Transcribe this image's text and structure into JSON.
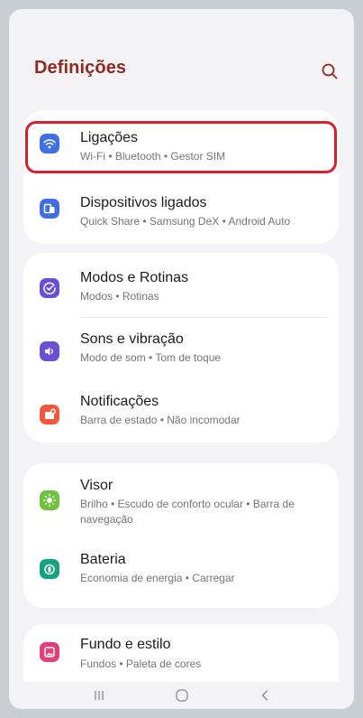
{
  "header": {
    "title": "Definições",
    "search_icon": "search-icon"
  },
  "groups": [
    {
      "items": [
        {
          "title": "Ligações",
          "subtitle": "Wi-Fi  •  Bluetooth  •  Gestor SIM",
          "icon": "wifi-icon",
          "color": "#3f6fe0"
        },
        {
          "title": "Dispositivos ligados",
          "subtitle": "Quick Share  •  Samsung DeX  •  Android Auto",
          "icon": "devices-icon",
          "color": "#3f6fe0"
        }
      ]
    },
    {
      "items": [
        {
          "title": "Modos e Rotinas",
          "subtitle": "Modos  •  Rotinas",
          "icon": "modes-check-icon",
          "color": "#6a4fd4"
        },
        {
          "title": "Sons e vibração",
          "subtitle": "Modo de som  •  Tom de toque",
          "icon": "speaker-icon",
          "color": "#6a4fd4"
        },
        {
          "title": "Notificações",
          "subtitle": "Barra de estado  •  Não incomodar",
          "icon": "notification-icon",
          "color": "#f0573d"
        }
      ]
    },
    {
      "items": [
        {
          "title": "Visor",
          "subtitle": "Brilho  •  Escudo de conforto ocular  •  Barra de navegação",
          "icon": "brightness-icon",
          "color": "#6fc23c"
        },
        {
          "title": "Bateria",
          "subtitle": "Economia de energia  •  Carregar",
          "icon": "battery-icon",
          "color": "#14a37f"
        }
      ]
    },
    {
      "items": [
        {
          "title": "Fundo e estilo",
          "subtitle": "Fundos  •  Paleta de cores",
          "icon": "wallpaper-icon",
          "color": "#e43f7a"
        }
      ]
    }
  ],
  "highlight_color": "#d8202c",
  "navbar": {
    "recents": "recents-icon",
    "home": "home-icon",
    "back": "back-icon"
  }
}
